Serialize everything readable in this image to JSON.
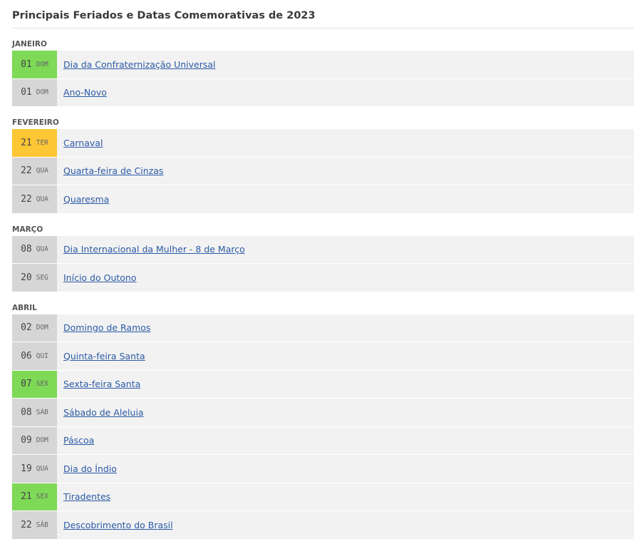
{
  "title": "Principais Feriados e Datas Comemorativas de 2023",
  "colors": {
    "holiday": "#7ed957",
    "optional": "#fdc634",
    "regular": "#d6d6d6",
    "link": "#2b5aa6"
  },
  "months": [
    {
      "label": "JANEIRO",
      "items": [
        {
          "day": "01",
          "weekday": "DOM",
          "name": "Dia da Confraternização Universal",
          "kind": "green"
        },
        {
          "day": "01",
          "weekday": "DOM",
          "name": "Ano-Novo",
          "kind": "gray"
        }
      ]
    },
    {
      "label": "FEVEREIRO",
      "items": [
        {
          "day": "21",
          "weekday": "TER",
          "name": "Carnaval",
          "kind": "yellow"
        },
        {
          "day": "22",
          "weekday": "QUA",
          "name": "Quarta-feira de Cinzas",
          "kind": "gray"
        },
        {
          "day": "22",
          "weekday": "QUA",
          "name": "Quaresma",
          "kind": "gray"
        }
      ]
    },
    {
      "label": "MARÇO",
      "items": [
        {
          "day": "08",
          "weekday": "QUA",
          "name": "Dia Internacional da Mulher - 8 de Março",
          "kind": "gray"
        },
        {
          "day": "20",
          "weekday": "SEG",
          "name": "Início do Outono",
          "kind": "gray"
        }
      ]
    },
    {
      "label": "ABRIL",
      "items": [
        {
          "day": "02",
          "weekday": "DOM",
          "name": "Domingo de Ramos",
          "kind": "gray"
        },
        {
          "day": "06",
          "weekday": "QUI",
          "name": "Quinta-feira Santa",
          "kind": "gray"
        },
        {
          "day": "07",
          "weekday": "SEX",
          "name": "Sexta-feira Santa",
          "kind": "green"
        },
        {
          "day": "08",
          "weekday": "SÁB",
          "name": "Sábado de Aleluia",
          "kind": "gray"
        },
        {
          "day": "09",
          "weekday": "DOM",
          "name": "Páscoa",
          "kind": "gray"
        },
        {
          "day": "19",
          "weekday": "QUA",
          "name": "Dia do Índio",
          "kind": "gray"
        },
        {
          "day": "21",
          "weekday": "SEX",
          "name": "Tiradentes",
          "kind": "green"
        },
        {
          "day": "22",
          "weekday": "SÁB",
          "name": "Descobrimento do Brasil",
          "kind": "gray"
        }
      ]
    }
  ]
}
